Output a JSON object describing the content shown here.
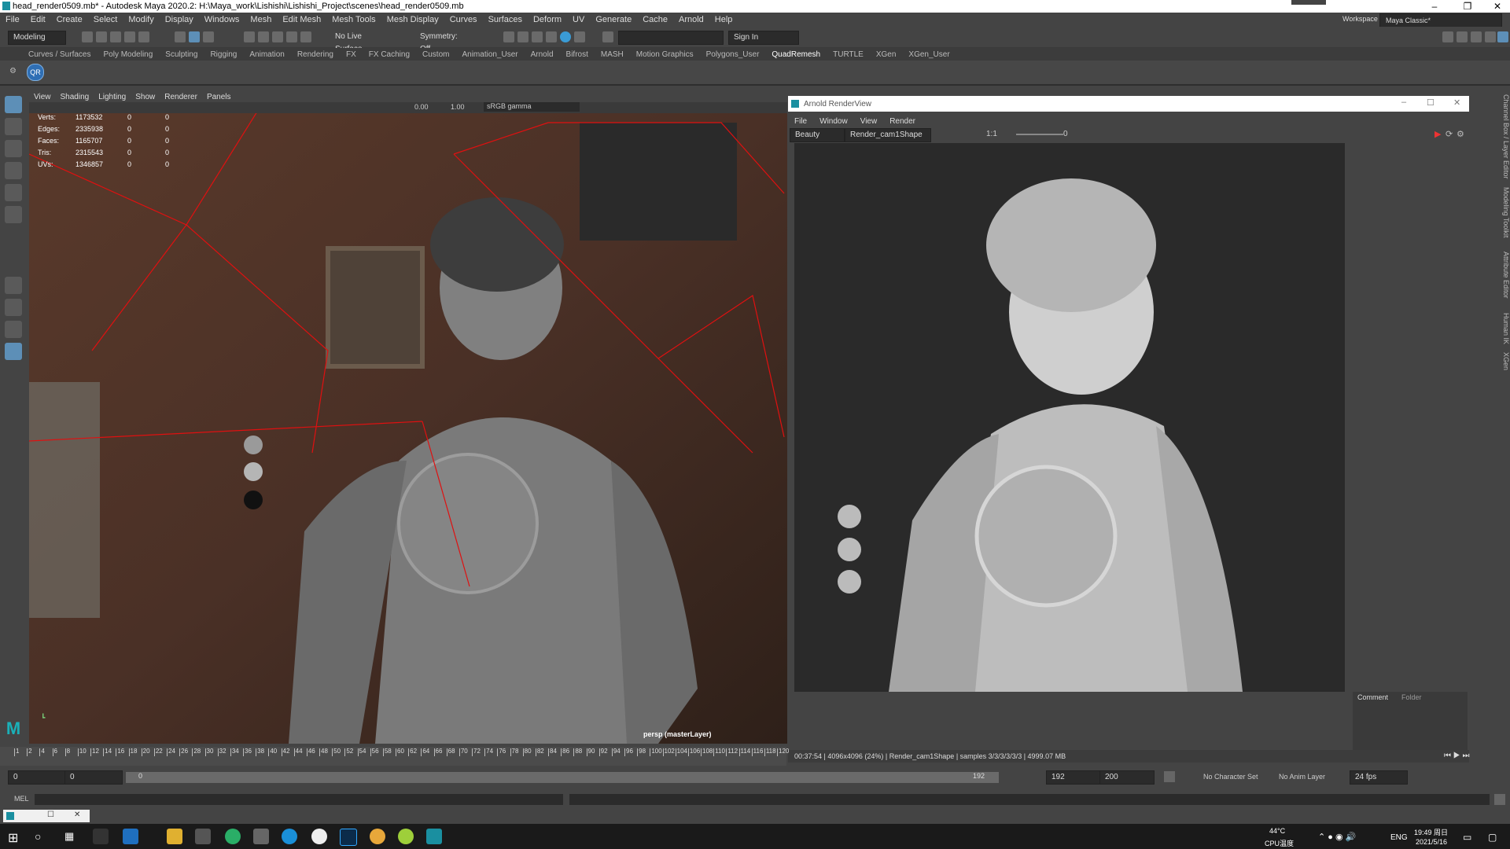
{
  "window": {
    "title": "head_render0509.mb* - Autodesk Maya 2020.2: H:\\Maya_work\\Lishishi\\Lishishi_Project\\scenes\\head_render0509.mb",
    "workspace_label": "Workspace :",
    "workspace_value": "Maya Classic*"
  },
  "menus": [
    "File",
    "Edit",
    "Create",
    "Select",
    "Modify",
    "Display",
    "Windows",
    "Mesh",
    "Edit Mesh",
    "Mesh Tools",
    "Mesh Display",
    "Curves",
    "Surfaces",
    "Deform",
    "UV",
    "Generate",
    "Cache",
    "Arnold",
    "Help"
  ],
  "statusline": {
    "mode": "Modeling",
    "live_surface": "No Live Surface",
    "symmetry": "Symmetry: Off",
    "sign_in": "Sign In"
  },
  "shelf_tabs": [
    "Curves / Surfaces",
    "Poly Modeling",
    "Sculpting",
    "Rigging",
    "Animation",
    "Rendering",
    "FX",
    "FX Caching",
    "Custom",
    "Animation_User",
    "Arnold",
    "Bifrost",
    "MASH",
    "Motion Graphics",
    "Polygons_User",
    "QuadRemesh",
    "TURTLE",
    "XGen",
    "XGen_User"
  ],
  "shelf_active": "QuadRemesh",
  "shelf_button": "QR",
  "viewport": {
    "menus": [
      "View",
      "Shading",
      "Lighting",
      "Show",
      "Renderer",
      "Panels"
    ],
    "exposure": "0.00",
    "gamma": "1.00",
    "color_space": "sRGB gamma",
    "camera_label": "persp (masterLayer)",
    "hud": [
      {
        "label": "Verts:",
        "v1": "1173532",
        "v2": "0",
        "v3": "0"
      },
      {
        "label": "Edges:",
        "v1": "2335938",
        "v2": "0",
        "v3": "0"
      },
      {
        "label": "Faces:",
        "v1": "1165707",
        "v2": "0",
        "v3": "0"
      },
      {
        "label": "Tris:",
        "v1": "2315543",
        "v2": "0",
        "v3": "0"
      },
      {
        "label": "UVs:",
        "v1": "1346857",
        "v2": "0",
        "v3": "0"
      }
    ]
  },
  "renderview": {
    "title": "Arnold RenderView",
    "menus": [
      "File",
      "Window",
      "View",
      "Render"
    ],
    "aov": "Beauty",
    "camera": "Render_cam1Shape",
    "ratio": "1:1",
    "exposure": "0",
    "info": "00:37:54 | 4096x4096 (24%) | Render_cam1Shape | samples 3/3/3/3/3/3 | 4999.07 MB",
    "side_tabs": [
      "Comment",
      "Folder"
    ]
  },
  "timeline": {
    "ticks": [
      "1",
      "2",
      "4",
      "6",
      "8",
      "10",
      "12",
      "14",
      "16",
      "18",
      "20",
      "22",
      "24",
      "26",
      "28",
      "30",
      "32",
      "34",
      "36",
      "38",
      "40",
      "42",
      "44",
      "46",
      "48",
      "50",
      "52",
      "54",
      "56",
      "58",
      "60",
      "62",
      "64",
      "66",
      "68",
      "70",
      "72",
      "74",
      "76",
      "78",
      "80",
      "82",
      "84",
      "86",
      "88",
      "90",
      "92",
      "94",
      "96",
      "98",
      "100",
      "102",
      "104",
      "106",
      "108",
      "110",
      "112",
      "114",
      "116",
      "118",
      "120"
    ],
    "start": "0",
    "start2": "0",
    "slider_start": "0",
    "slider_end": "192",
    "end": "192",
    "end2": "200",
    "char_set": "No Character Set",
    "anim_layer": "No Anim Layer",
    "fps": "24 fps"
  },
  "command_line": {
    "label": "MEL"
  },
  "right_tabs": [
    "Channel Box / Layer Editor",
    "Modeling Toolkit",
    "Attribute Editor",
    "Human IK",
    "XGen"
  ],
  "taskbar": {
    "temp": "44°C",
    "cpu": "CPU温度",
    "lang": "ENG",
    "time": "19:49 周日",
    "date": "2021/5/16"
  }
}
